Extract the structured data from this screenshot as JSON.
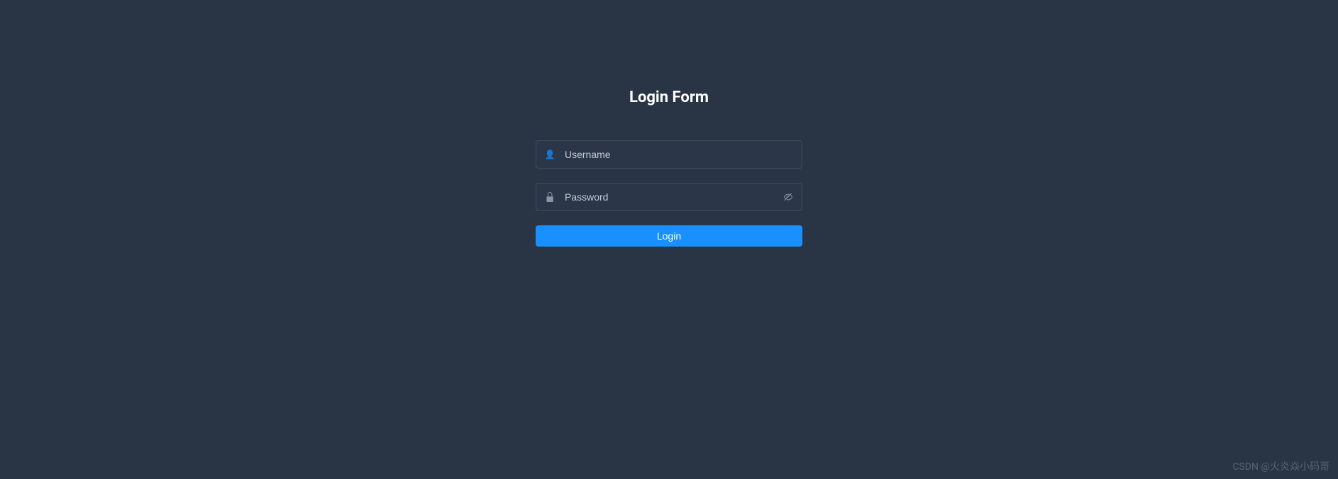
{
  "form": {
    "title": "Login Form",
    "username": {
      "placeholder": "Username",
      "value": ""
    },
    "password": {
      "placeholder": "Password",
      "value": ""
    },
    "submit_label": "Login"
  },
  "watermark": "CSDN @火炎焱小码哥"
}
